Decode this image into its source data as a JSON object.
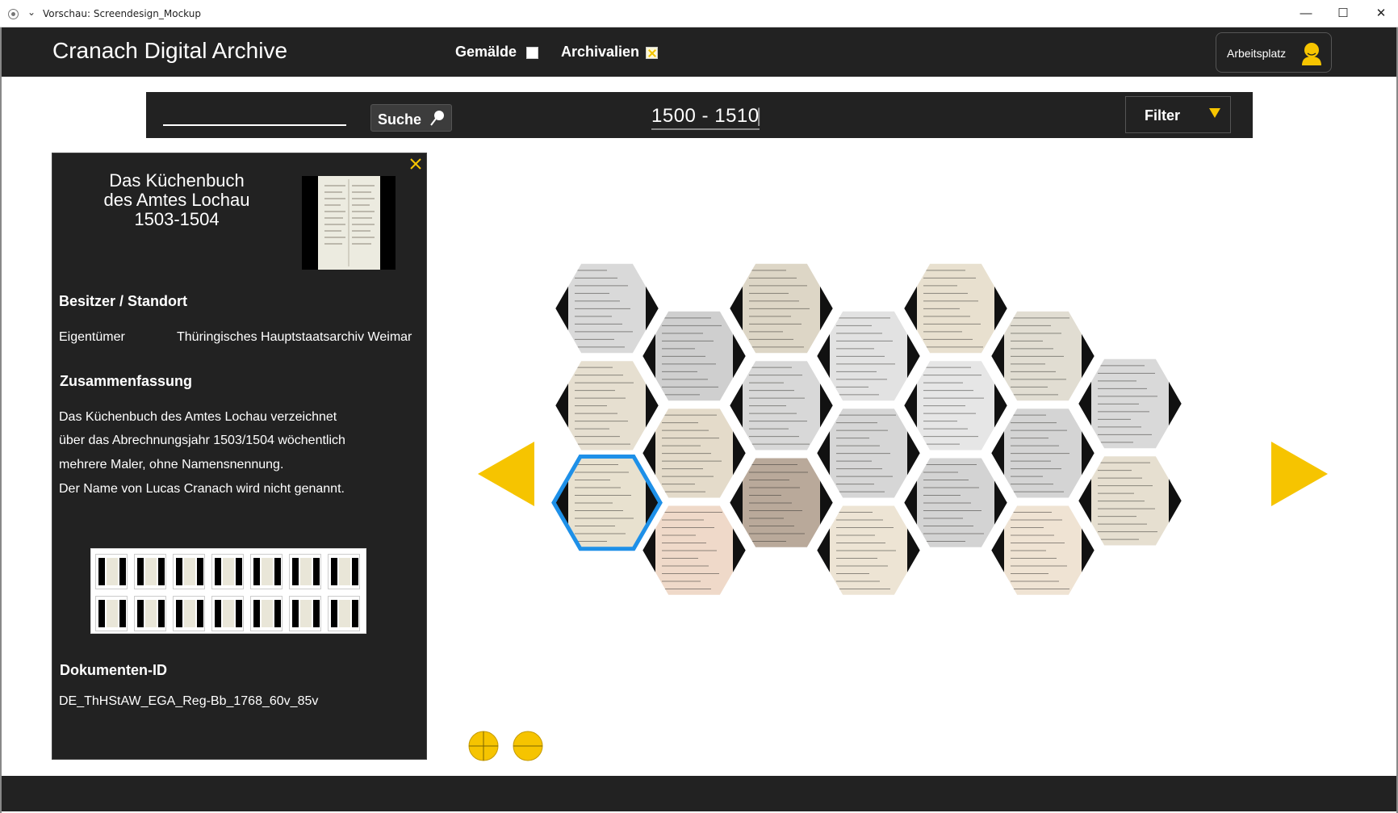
{
  "window": {
    "title": "Vorschau: Screendesign_Mockup",
    "min_icon": "minimize-icon",
    "max_icon": "maximize-icon",
    "close_icon": "close-icon"
  },
  "header": {
    "brand": "Cranach Digital Archive",
    "toggles": [
      {
        "label": "Gemälde",
        "checked": false
      },
      {
        "label": "Archivalien",
        "checked": true
      }
    ],
    "workspace_label": "Arbeitsplatz",
    "workspace_icon": "user-avatar-icon"
  },
  "search": {
    "value": "",
    "placeholder": "",
    "button_label": "Suche",
    "button_icon": "magnifier-icon",
    "range": "1500 - 1510",
    "filter_label": "Filter",
    "filter_icon": "triangle-down-icon"
  },
  "detail": {
    "title_lines": [
      "Das Küchenbuch",
      "des Amtes Lochau",
      "1503-1504"
    ],
    "section_owner": "Besitzer / Standort",
    "owner_key": "Eigentümer",
    "owner_value": "Thüringisches Hauptstaatsarchiv Weimar",
    "section_summary": "Zusammenfassung",
    "summary_lines": [
      "Das Küchenbuch des Amtes Lochau verzeichnet",
      "über das Abrechnungsjahr 1503/1504 wöchentlich",
      "mehrere Maler, ohne Namensnennung.",
      "Der Name von Lucas Cranach wird nicht genannt."
    ],
    "section_docid": "Dokumenten-ID",
    "docid": "DE_ThHStAW_EGA_Reg-Bb_1768_60v_85v",
    "page_thumb_count": 14
  },
  "gallery": {
    "selected_index": 2,
    "tile_tones": [
      "#d9d9d9",
      "#e6dfd0",
      "#e8e1cf",
      "#cfcfcf",
      "#e4dbca",
      "#efd9c9",
      "#ddd6c6",
      "#d8d8d8",
      "#b9a99a",
      "#e2e2e2",
      "#d6d6d6",
      "#ede4d4",
      "#e8e0cf",
      "#e6e6e6",
      "#d3d3d3",
      "#e1ddd2",
      "#d4d4d4",
      "#efe3d3"
    ],
    "prev_icon": "arrow-left-icon",
    "next_icon": "arrow-right-icon",
    "zoom_in_icon": "zoom-in-icon",
    "zoom_out_icon": "zoom-out-icon"
  },
  "colors": {
    "accent": "#f6c400",
    "dark": "#222222",
    "selection": "#1e90e8"
  }
}
